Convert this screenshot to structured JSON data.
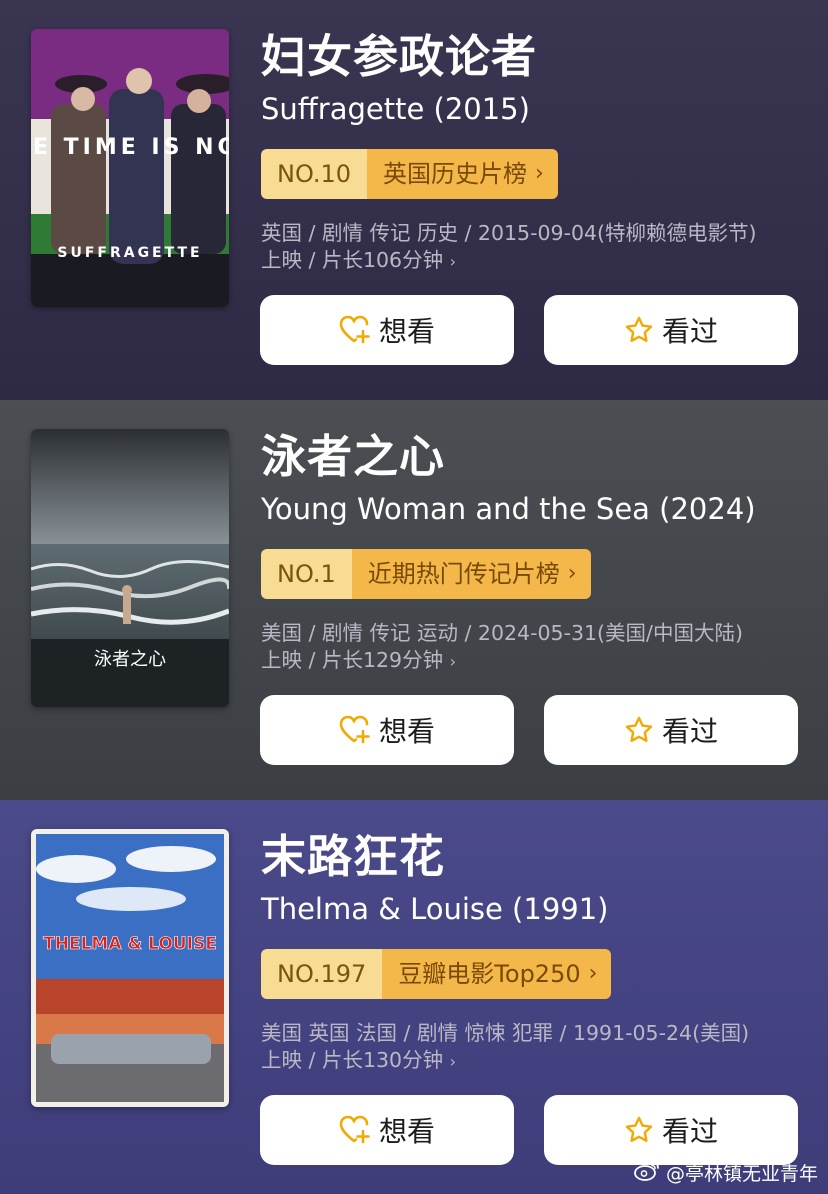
{
  "movies": [
    {
      "title_cn": "妇女参政论者",
      "title_en": "Suffragette (2015)",
      "rank_no": "NO.10",
      "rank_list": "英国历史片榜",
      "meta_line1": "英国 / 剧情 传记 历史 / 2015-09-04(特柳赖德电影节)",
      "meta_line2": "上映 / 片长106分钟",
      "poster_text_main": "SUFFRAGETTE",
      "poster_text_tagline": "THE TIME IS NOW"
    },
    {
      "title_cn": "泳者之心",
      "title_en": "Young Woman and the Sea (2024)",
      "rank_no": "NO.1",
      "rank_list": "近期热门传记片榜",
      "meta_line1": "美国 / 剧情 传记 运动 / 2024-05-31(美国/中国大陆)",
      "meta_line2": "上映 / 片长129分钟",
      "poster_text_main": "泳者之心"
    },
    {
      "title_cn": "末路狂花",
      "title_en": "Thelma & Louise (1991)",
      "rank_no": "NO.197",
      "rank_list": "豆瓣电影Top250",
      "meta_line1": "美国 英国 法国 / 剧情 惊悚 犯罪 / 1991-05-24(美国)",
      "meta_line2": "上映 / 片长130分钟",
      "poster_text_main": "THELMA & LOUISE"
    }
  ],
  "buttons": {
    "want": "想看",
    "seen": "看过"
  },
  "icons": {
    "want": "heart-plus-icon",
    "seen": "star-outline-icon",
    "chevron": "chevron-right-icon"
  },
  "watermark": "@亭林镇无业青年",
  "colors": {
    "rank_no_bg": "#f8dc93",
    "rank_list_bg": "#f4b84a",
    "icon_accent": "#f2a900"
  }
}
